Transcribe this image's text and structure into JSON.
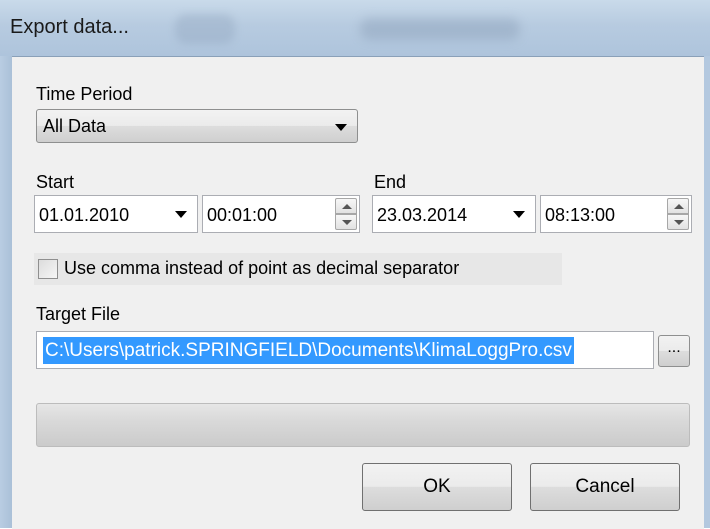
{
  "window": {
    "title": "Export data..."
  },
  "time_period": {
    "label": "Time Period",
    "selected": "All Data"
  },
  "start": {
    "label": "Start",
    "date": "01.01.2010",
    "time": "00:01:00"
  },
  "end": {
    "label": "End",
    "date": "23.03.2014",
    "time": "08:13:00"
  },
  "options": {
    "decimal_separator_label": "Use comma instead of point as decimal separator",
    "decimal_separator_checked": false
  },
  "target_file": {
    "label": "Target File",
    "path": "C:\\Users\\patrick.SPRINGFIELD\\Documents\\KlimaLoggPro.csv",
    "browse_label": "..."
  },
  "progress": {
    "value": 0
  },
  "buttons": {
    "ok": "OK",
    "cancel": "Cancel"
  },
  "colors": {
    "selection": "#3399ff",
    "titlebar": "#b7cbe0",
    "dialog_bg": "#f0f0f0"
  }
}
